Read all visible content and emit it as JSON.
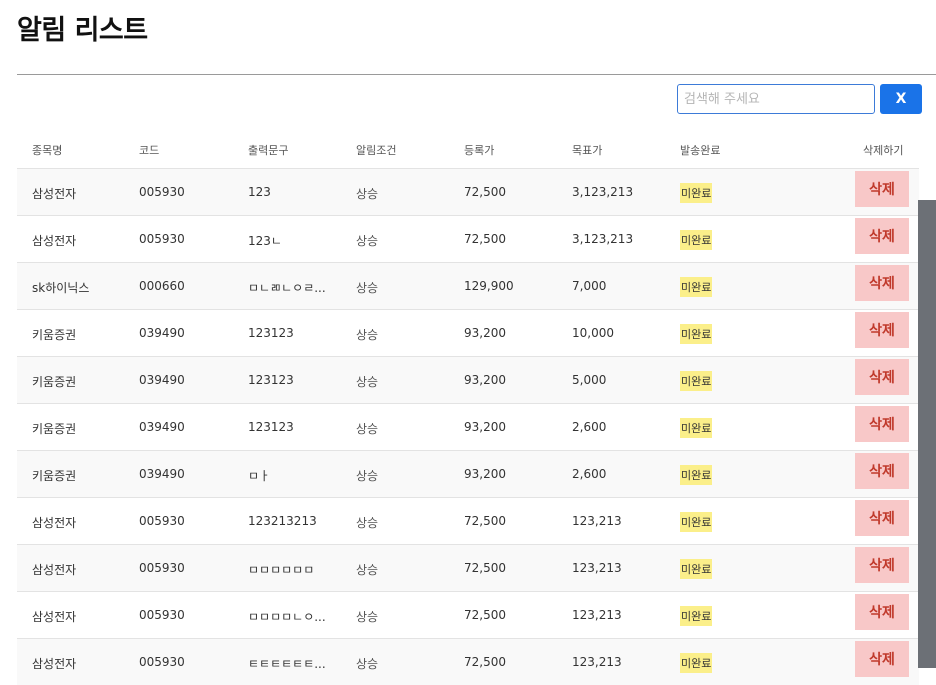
{
  "page": {
    "title": "알림 리스트"
  },
  "search": {
    "placeholder": "검색해 주세요",
    "clear_label": "X"
  },
  "table": {
    "columns": [
      "종목명",
      "코드",
      "출력문구",
      "알림조건",
      "등록가",
      "목표가",
      "발송완료",
      "삭제하기"
    ],
    "delete_label": "삭제",
    "rows": [
      {
        "name": "삼성전자",
        "code": "005930",
        "message": "123",
        "condition": "상승",
        "reg_price": "72,500",
        "target_price": "3,123,213",
        "status": "미완료"
      },
      {
        "name": "삼성전자",
        "code": "005930",
        "message": "123ㄴ",
        "condition": "상승",
        "reg_price": "72,500",
        "target_price": "3,123,213",
        "status": "미완료"
      },
      {
        "name": "sk하이닉스",
        "code": "000660",
        "message": "ㅁㄴㄻㄴㅇㄹ...",
        "condition": "상승",
        "reg_price": "129,900",
        "target_price": "7,000",
        "status": "미완료"
      },
      {
        "name": "키움증권",
        "code": "039490",
        "message": "123123",
        "condition": "상승",
        "reg_price": "93,200",
        "target_price": "10,000",
        "status": "미완료"
      },
      {
        "name": "키움증권",
        "code": "039490",
        "message": "123123",
        "condition": "상승",
        "reg_price": "93,200",
        "target_price": "5,000",
        "status": "미완료"
      },
      {
        "name": "키움증권",
        "code": "039490",
        "message": "123123",
        "condition": "상승",
        "reg_price": "93,200",
        "target_price": "2,600",
        "status": "미완료"
      },
      {
        "name": "키움증권",
        "code": "039490",
        "message": "ㅁㅏ",
        "condition": "상승",
        "reg_price": "93,200",
        "target_price": "2,600",
        "status": "미완료"
      },
      {
        "name": "삼성전자",
        "code": "005930",
        "message": "123213213",
        "condition": "상승",
        "reg_price": "72,500",
        "target_price": "123,213",
        "status": "미완료"
      },
      {
        "name": "삼성전자",
        "code": "005930",
        "message": "ㅁㅁㅁㅁㅁㅁ",
        "condition": "상승",
        "reg_price": "72,500",
        "target_price": "123,213",
        "status": "미완료"
      },
      {
        "name": "삼성전자",
        "code": "005930",
        "message": "ㅁㅁㅁㅁㄴㅇ...",
        "condition": "상승",
        "reg_price": "72,500",
        "target_price": "123,213",
        "status": "미완료"
      },
      {
        "name": "삼성전자",
        "code": "005930",
        "message": "ㅌㅌㅌㅌㅌㅌ...",
        "condition": "상승",
        "reg_price": "72,500",
        "target_price": "123,213",
        "status": "미완료"
      }
    ]
  }
}
